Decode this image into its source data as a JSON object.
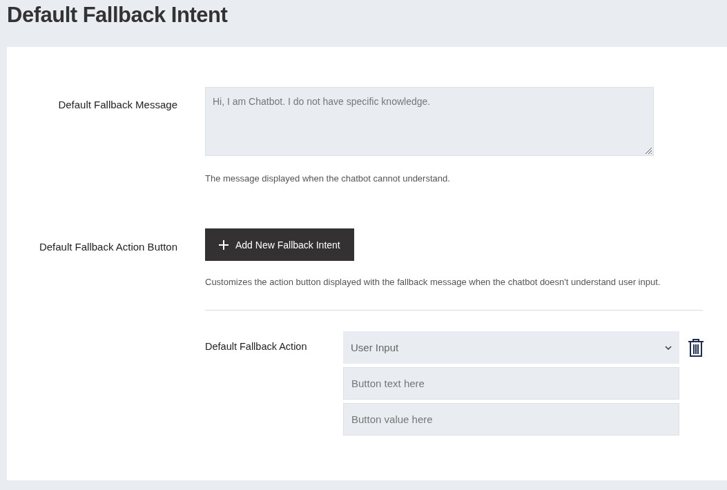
{
  "page": {
    "title": "Default Fallback Intent"
  },
  "message": {
    "label": "Default Fallback Message",
    "placeholder": "Hi, I am Chatbot. I do not have specific knowledge.",
    "help": "The message displayed when the chatbot cannot understand."
  },
  "action_button": {
    "label": "Default Fallback Action Button",
    "button": "Add New Fallback Intent",
    "help": "Customizes the action button displayed with the fallback message when the chatbot doesn't understand user input."
  },
  "action": {
    "label": "Default Fallback Action",
    "select": "User Input",
    "fields": [
      {
        "placeholder": "Button text here"
      },
      {
        "placeholder": "Button value here"
      }
    ]
  }
}
